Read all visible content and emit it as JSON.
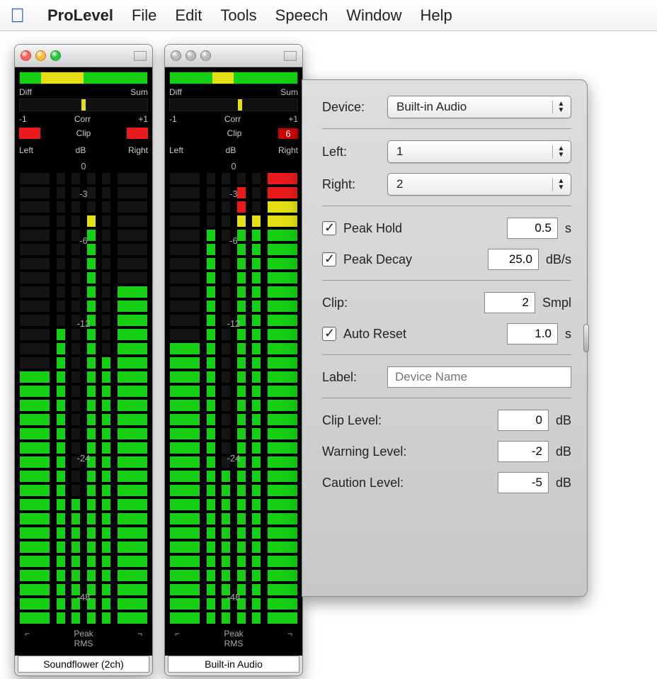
{
  "menubar": {
    "app": "ProLevel",
    "items": [
      "File",
      "Edit",
      "Tools",
      "Speech",
      "Window",
      "Help"
    ]
  },
  "meters": [
    {
      "active_window": true,
      "topbar": {
        "left": "Diff",
        "right": "Sum"
      },
      "diffsum_segments": [
        "green",
        "yellow",
        "yellow",
        "green",
        "green",
        "green"
      ],
      "corr": {
        "left": "-1",
        "center": "Corr",
        "right": "+1",
        "value_pos": 0.5
      },
      "clip": {
        "label": "Clip",
        "value": "",
        "show_badge": false,
        "left_red": true,
        "right_red": true
      },
      "lr_header": {
        "left": "Left",
        "center": "dB",
        "right": "Right"
      },
      "db_readout": "0",
      "scale_ticks": [
        "0",
        "-3",
        "-6",
        "-12",
        "-24",
        "-48"
      ],
      "columns_fill": [
        18,
        21,
        9,
        29,
        19,
        24
      ],
      "columns_width": [
        "wide",
        "narrow",
        "narrow",
        "narrow",
        "narrow",
        "wide"
      ],
      "peak_left": "⌐",
      "peak_mid_top": "Peak",
      "peak_mid_bot": "RMS",
      "peak_right": "¬",
      "device_label": "Soundflower (2ch)"
    },
    {
      "active_window": false,
      "topbar": {
        "left": "Diff",
        "right": "Sum"
      },
      "diffsum_segments": [
        "green",
        "green",
        "yellow",
        "green",
        "green",
        "green"
      ],
      "corr": {
        "left": "-1",
        "center": "Corr",
        "right": "+1",
        "value_pos": 0.55
      },
      "clip": {
        "label": "Clip",
        "value": "6",
        "show_badge": true,
        "left_red": false,
        "right_red": false
      },
      "lr_header": {
        "left": "Left",
        "center": "dB",
        "right": "Right"
      },
      "db_readout": "0",
      "scale_ticks": [
        "0",
        "-3",
        "-6",
        "-12",
        "-24",
        "-48"
      ],
      "columns_fill": [
        20,
        28,
        11,
        31,
        29,
        32
      ],
      "columns_width": [
        "wide",
        "narrow",
        "narrow",
        "narrow",
        "narrow",
        "wide"
      ],
      "columns_red_top": [
        0,
        0,
        0,
        2,
        0,
        2
      ],
      "peak_left": "⌐",
      "peak_mid_top": "Peak",
      "peak_mid_bot": "RMS",
      "peak_right": "¬",
      "device_label": "Built-in Audio"
    }
  ],
  "settings": {
    "device_label": "Device:",
    "device_value": "Built-in Audio",
    "left_label": "Left:",
    "left_value": "1",
    "right_label": "Right:",
    "right_value": "2",
    "peak_hold_checked": true,
    "peak_hold_label": "Peak Hold",
    "peak_hold_value": "0.5",
    "peak_hold_unit": "s",
    "peak_decay_checked": true,
    "peak_decay_label": "Peak Decay",
    "peak_decay_value": "25.0",
    "peak_decay_unit": "dB/s",
    "clip_label": "Clip:",
    "clip_value": "2",
    "clip_unit": "Smpl",
    "auto_reset_checked": true,
    "auto_reset_label": "Auto Reset",
    "auto_reset_value": "1.0",
    "auto_reset_unit": "s",
    "label_label": "Label:",
    "label_placeholder": "Device Name",
    "clip_level_label": "Clip Level:",
    "clip_level_value": "0",
    "warning_level_label": "Warning Level:",
    "warning_level_value": "-2",
    "caution_level_label": "Caution Level:",
    "caution_level_value": "-5",
    "db_unit": "dB"
  },
  "meter_config": {
    "total_cells": 32,
    "yellow_start": 28,
    "red_start": 31
  }
}
